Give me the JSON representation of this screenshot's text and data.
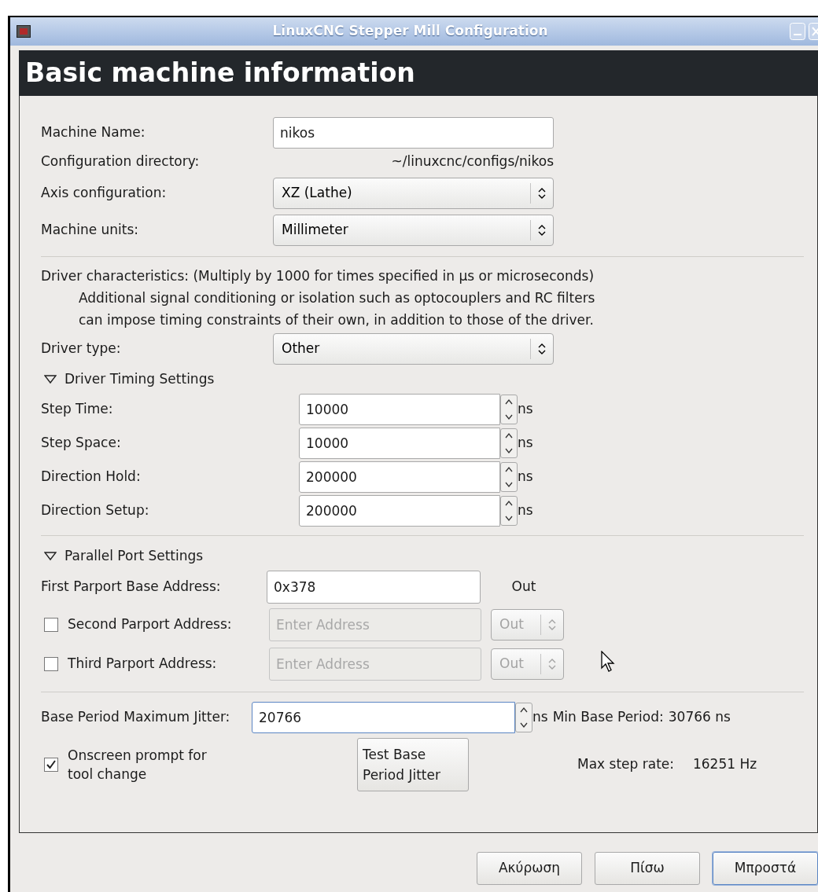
{
  "window": {
    "title": "LinuxCNC Stepper Mill Configuration"
  },
  "heading": "Basic machine information",
  "machine": {
    "name": {
      "label": "Machine Name:",
      "value": "nikos"
    },
    "config_dir": {
      "label": "Configuration directory:",
      "value": "~/linuxcnc/configs/nikos"
    },
    "axis": {
      "label": "Axis configuration:",
      "value": "XZ (Lathe)"
    },
    "units": {
      "label": "Machine units:",
      "value": "Millimeter"
    }
  },
  "driver": {
    "notes": [
      "Driver characteristics: (Multiply by 1000 for times specified in µs or microseconds)",
      "Additional signal conditioning or isolation such as optocouplers and RC filters",
      "can impose timing constraints of their own, in addition to those of the driver."
    ],
    "type": {
      "label": "Driver type:",
      "value": "Other"
    }
  },
  "timing": {
    "title": "Driver Timing Settings",
    "expanded": true,
    "rows": [
      {
        "label": "Step Time:",
        "value": "10000",
        "unit": "ns"
      },
      {
        "label": "Step Space:",
        "value": "10000",
        "unit": "ns"
      },
      {
        "label": "Direction Hold:",
        "value": "200000",
        "unit": "ns"
      },
      {
        "label": "Direction Setup:",
        "value": "200000",
        "unit": "ns"
      }
    ]
  },
  "parport": {
    "title": "Parallel Port Settings",
    "expanded": true,
    "ports": [
      {
        "kind": "fixed",
        "label": "First Parport Base Address:",
        "value": "0x378",
        "direction": "Out"
      },
      {
        "kind": "optional",
        "checked": false,
        "label": "Second Parport Address:",
        "placeholder": "Enter Address",
        "direction": "Out"
      },
      {
        "kind": "optional",
        "checked": false,
        "label": "Third Parport Address:",
        "placeholder": "Enter Address",
        "direction": "Out"
      }
    ]
  },
  "jitter": {
    "label": "Base Period Maximum Jitter:",
    "value": "20766",
    "unit": "ns",
    "focused": true,
    "min_period_label": "Min Base Period:",
    "min_period_value": "30766 ns"
  },
  "tool_prompt": {
    "label": "Onscreen prompt for tool change",
    "checked": true
  },
  "test_button": {
    "label": "Test Base Period Jitter"
  },
  "max_step_rate": {
    "label": "Max step rate:",
    "value": "16251 Hz"
  },
  "buttons": [
    {
      "label": "Ακύρωση",
      "default": false
    },
    {
      "label": "Πίσω",
      "default": false
    },
    {
      "label": "Μπροστά",
      "default": true
    }
  ]
}
